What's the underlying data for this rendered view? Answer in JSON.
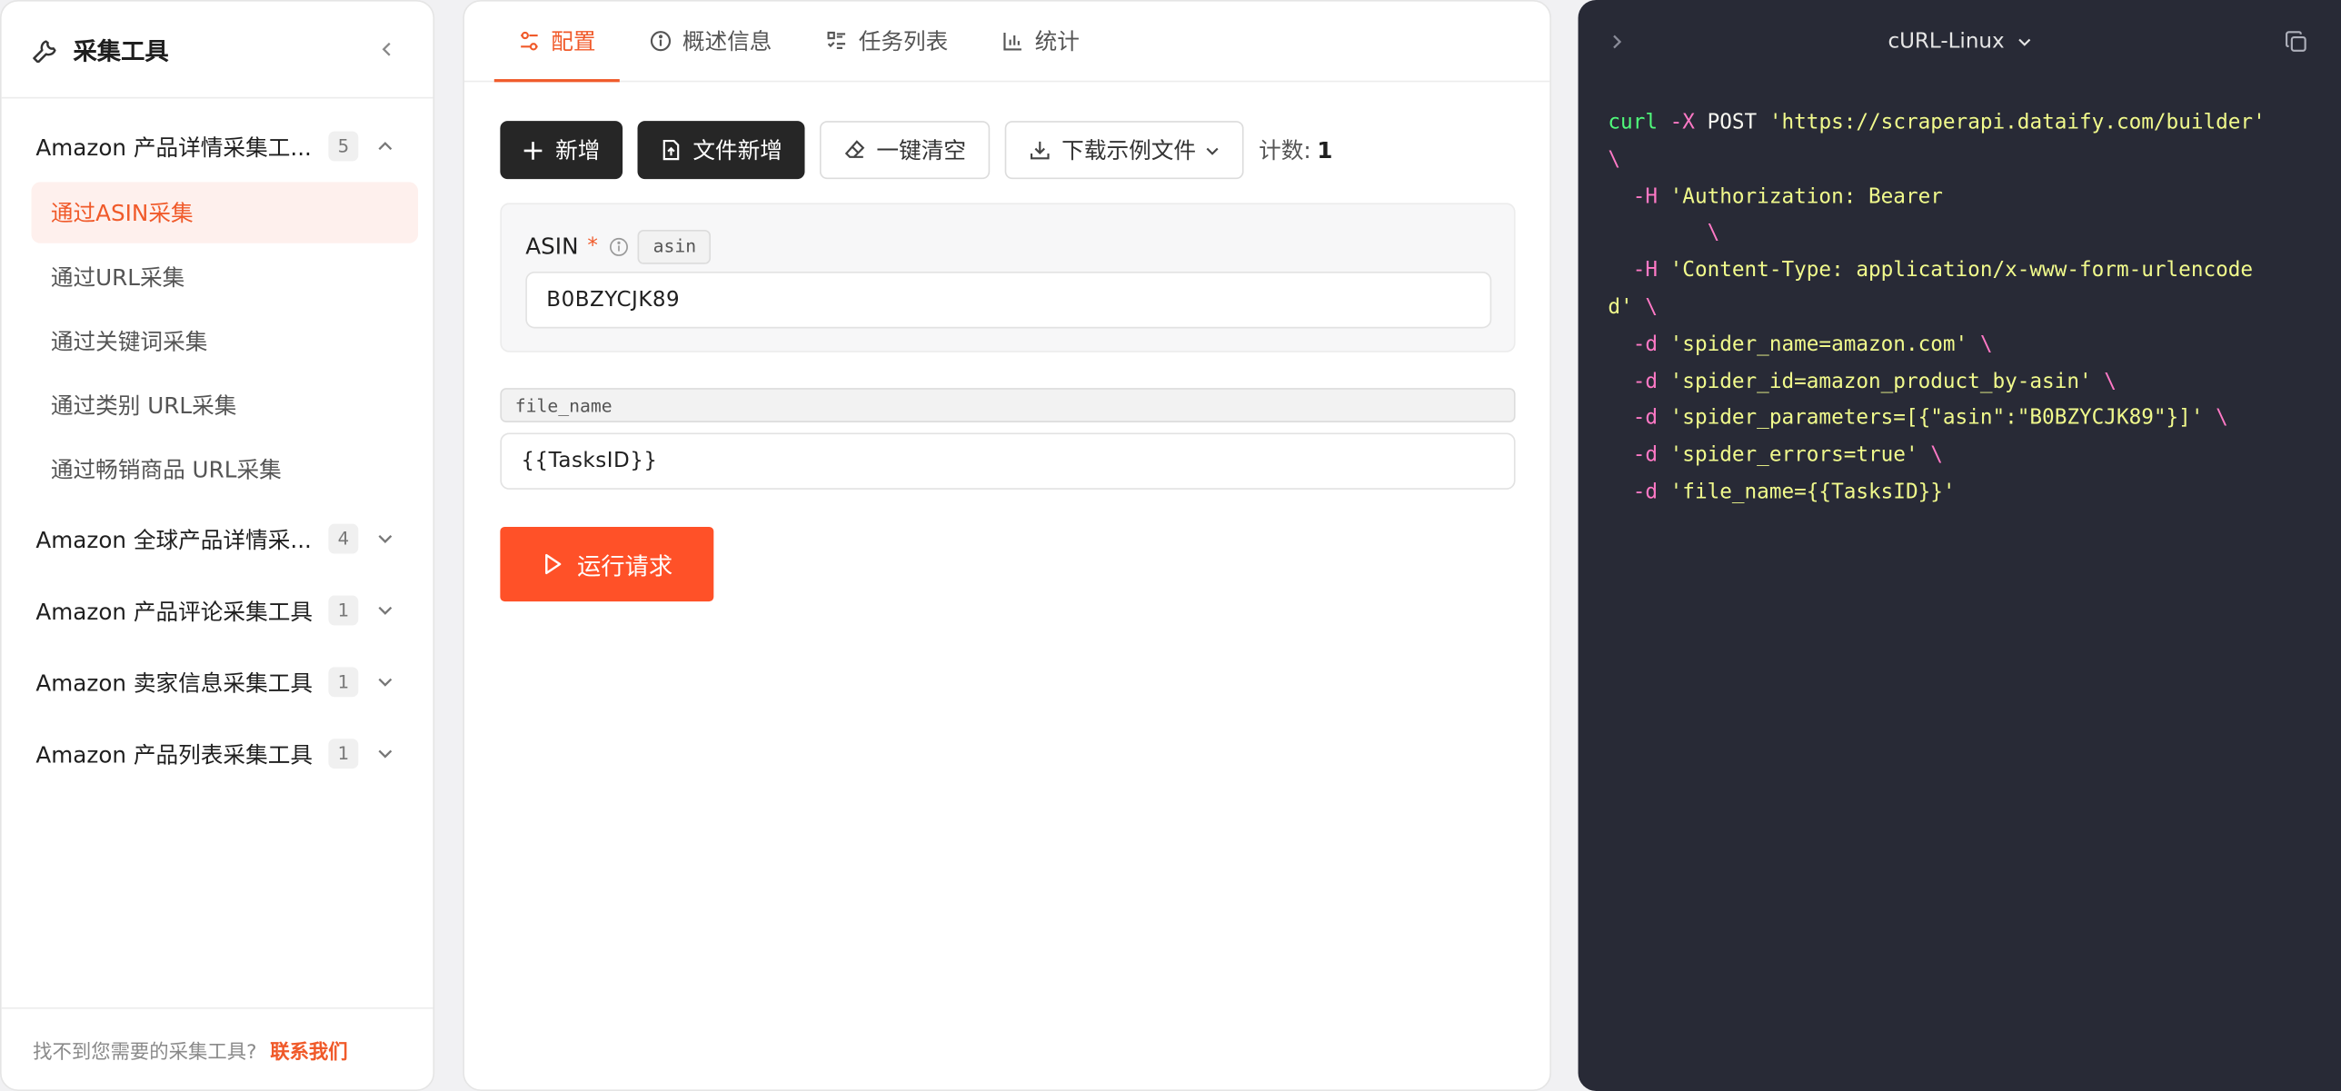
{
  "sidebar": {
    "title": "采集工具",
    "groups": [
      {
        "label": "Amazon 产品详情采集工...",
        "count": "5",
        "expanded": true
      },
      {
        "label": "Amazon 全球产品详情采...",
        "count": "4",
        "expanded": false
      },
      {
        "label": "Amazon 产品评论采集工具",
        "count": "1",
        "expanded": false
      },
      {
        "label": "Amazon 卖家信息采集工具",
        "count": "1",
        "expanded": false
      },
      {
        "label": "Amazon 产品列表采集工具",
        "count": "1",
        "expanded": false
      }
    ],
    "subitems": [
      {
        "label": "通过ASIN采集",
        "active": true
      },
      {
        "label": "通过URL采集",
        "active": false
      },
      {
        "label": "通过关键词采集",
        "active": false
      },
      {
        "label": "通过类别 URL采集",
        "active": false
      },
      {
        "label": "通过畅销商品 URL采集",
        "active": false
      }
    ],
    "footer_text": "找不到您需要的采集工具?",
    "footer_link": "联系我们"
  },
  "tabs": [
    {
      "label": "配置",
      "icon": "sliders-icon",
      "active": true
    },
    {
      "label": "概述信息",
      "icon": "info-icon",
      "active": false
    },
    {
      "label": "任务列表",
      "icon": "list-icon",
      "active": false
    },
    {
      "label": "统计",
      "icon": "bar-chart-icon",
      "active": false
    }
  ],
  "toolbar": {
    "add_label": "新增",
    "file_add_label": "文件新增",
    "clear_label": "一键清空",
    "download_label": "下载示例文件",
    "count_label": "计数:",
    "count_value": "1"
  },
  "form": {
    "asin_label": "ASIN",
    "asin_required": "*",
    "asin_tag": "asin",
    "asin_value": "B0BZYCJK89",
    "file_name_tag": "file_name",
    "file_name_value": "{{TasksID}}",
    "run_label": "运行请求"
  },
  "code_panel": {
    "language": "cURL-Linux",
    "lines": [
      [
        {
          "t": "curl ",
          "c": "kw"
        },
        {
          "t": "-X ",
          "c": "op"
        },
        {
          "t": "POST ",
          "c": ""
        },
        {
          "t": "'https://scraperapi.dataify.com/builder'",
          "c": "str"
        }
      ],
      [
        {
          "t": "\\",
          "c": "op"
        }
      ],
      [
        {
          "t": "  -H ",
          "c": "op"
        },
        {
          "t": "'Authorization: Bearer",
          "c": "str"
        }
      ],
      [
        {
          "t": "        \\",
          "c": "op"
        }
      ],
      [
        {
          "t": "  -H ",
          "c": "op"
        },
        {
          "t": "'Content-Type: application/x-www-form-urlencode",
          "c": "str"
        }
      ],
      [
        {
          "t": "d' ",
          "c": "str"
        },
        {
          "t": "\\",
          "c": "op"
        }
      ],
      [
        {
          "t": "  -d ",
          "c": "op"
        },
        {
          "t": "'spider_name=amazon.com' ",
          "c": "str"
        },
        {
          "t": "\\",
          "c": "op"
        }
      ],
      [
        {
          "t": "  -d ",
          "c": "op"
        },
        {
          "t": "'spider_id=amazon_product_by-asin' ",
          "c": "str"
        },
        {
          "t": "\\",
          "c": "op"
        }
      ],
      [
        {
          "t": "  -d ",
          "c": "op"
        },
        {
          "t": "'spider_parameters=[{\"asin\":\"B0BZYCJK89\"}]' ",
          "c": "str"
        },
        {
          "t": "\\",
          "c": "op"
        }
      ],
      [
        {
          "t": "  -d ",
          "c": "op"
        },
        {
          "t": "'spider_errors=true' ",
          "c": "str"
        },
        {
          "t": "\\",
          "c": "op"
        }
      ],
      [
        {
          "t": "  -d ",
          "c": "op"
        },
        {
          "t": "'file_name={{TasksID}}'",
          "c": "str"
        }
      ]
    ]
  },
  "colors": {
    "accent": "#f05a2a",
    "run_button": "#ff5128",
    "code_bg": "#282a36"
  }
}
